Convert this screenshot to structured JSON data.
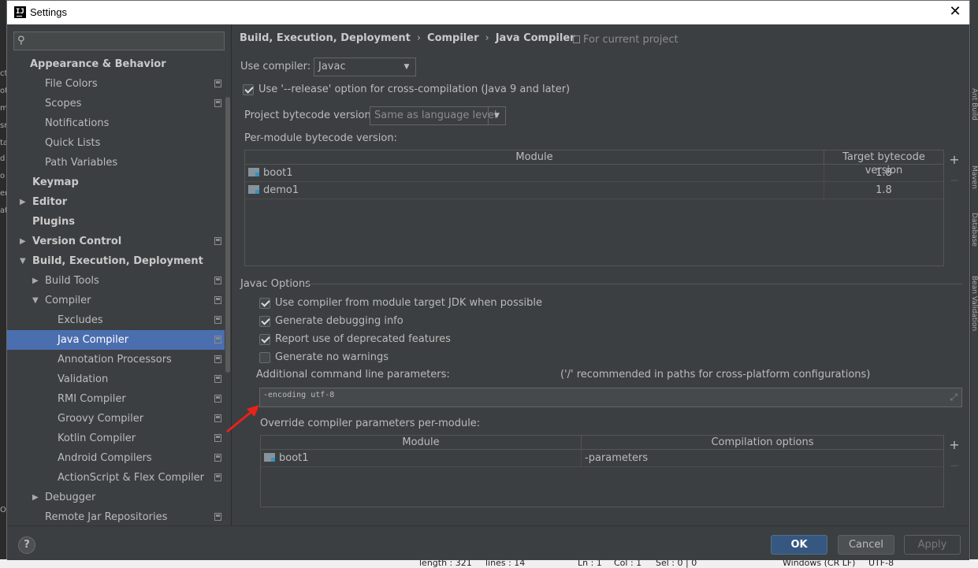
{
  "window": {
    "title": "Settings",
    "close_label": "✕"
  },
  "search": {
    "placeholder": ""
  },
  "tree": [
    {
      "label": "Appearance & Behavior",
      "bold": true,
      "indent": 0,
      "arrow": "",
      "proj": false
    },
    {
      "label": "File Colors",
      "indent": 1,
      "proj": true
    },
    {
      "label": "Scopes",
      "indent": 1,
      "proj": true
    },
    {
      "label": "Notifications",
      "indent": 1,
      "proj": false
    },
    {
      "label": "Quick Lists",
      "indent": 1,
      "proj": false
    },
    {
      "label": "Path Variables",
      "indent": 1,
      "proj": false
    },
    {
      "label": "Keymap",
      "bold": true,
      "indent": 0,
      "proj": false
    },
    {
      "label": "Editor",
      "bold": true,
      "indent": 0,
      "arrow": "▶",
      "proj": false
    },
    {
      "label": "Plugins",
      "bold": true,
      "indent": 0,
      "proj": false
    },
    {
      "label": "Version Control",
      "bold": true,
      "indent": 0,
      "arrow": "▶",
      "proj": true
    },
    {
      "label": "Build, Execution, Deployment",
      "bold": true,
      "indent": 0,
      "arrow": "▼",
      "proj": false
    },
    {
      "label": "Build Tools",
      "indent": 1,
      "arrow": "▶",
      "proj": true
    },
    {
      "label": "Compiler",
      "indent": 1,
      "arrow": "▼",
      "proj": true
    },
    {
      "label": "Excludes",
      "indent": 2,
      "proj": true
    },
    {
      "label": "Java Compiler",
      "indent": 2,
      "proj": true,
      "selected": true
    },
    {
      "label": "Annotation Processors",
      "indent": 2,
      "proj": true
    },
    {
      "label": "Validation",
      "indent": 2,
      "proj": true
    },
    {
      "label": "RMI Compiler",
      "indent": 2,
      "proj": true
    },
    {
      "label": "Groovy Compiler",
      "indent": 2,
      "proj": true
    },
    {
      "label": "Kotlin Compiler",
      "indent": 2,
      "proj": true
    },
    {
      "label": "Android Compilers",
      "indent": 2,
      "proj": true
    },
    {
      "label": "ActionScript & Flex Compiler",
      "indent": 2,
      "proj": true
    },
    {
      "label": "Debugger",
      "indent": 1,
      "arrow": "▶",
      "proj": false
    },
    {
      "label": "Remote Jar Repositories",
      "indent": 1,
      "proj": true
    }
  ],
  "breadcrumb": [
    "Build, Execution, Deployment",
    "Compiler",
    "Java Compiler"
  ],
  "for_current_project": "For current project",
  "use_compiler": {
    "label": "Use compiler:",
    "value": "Javac"
  },
  "release_option": {
    "label": "Use '--release' option for cross-compilation (Java 9 and later)",
    "checked": true
  },
  "project_bytecode": {
    "label": "Project bytecode version:",
    "value": "Same as language level"
  },
  "per_module": {
    "label": "Per-module bytecode version:",
    "columns": [
      "Module",
      "Target bytecode version"
    ],
    "rows": [
      {
        "module": "boot1",
        "version": "1.8"
      },
      {
        "module": "demo1",
        "version": "1.8"
      }
    ]
  },
  "javac_options": {
    "title": "Javac Options",
    "checkboxes": [
      {
        "label": "Use compiler from module target JDK when possible",
        "checked": true
      },
      {
        "label": "Generate debugging info",
        "checked": true
      },
      {
        "label": "Report use of deprecated features",
        "checked": true
      },
      {
        "label": "Generate no warnings",
        "checked": false
      }
    ],
    "additional_label": "Additional command line parameters:",
    "additional_hint": "('/' recommended in paths for cross-platform configurations)",
    "additional_value": "-encoding utf-8"
  },
  "override": {
    "label": "Override compiler parameters per-module:",
    "columns": [
      "Module",
      "Compilation options"
    ],
    "rows": [
      {
        "module": "boot1",
        "options": "-parameters"
      }
    ]
  },
  "table_buttons": {
    "add": "+",
    "remove": "—"
  },
  "footer": {
    "help": "?",
    "ok": "OK",
    "cancel": "Cancel",
    "apply": "Apply"
  },
  "background": {
    "status": [
      "length : 321",
      "lines : 14",
      "Ln : 1",
      "Col : 1",
      "Sel : 0 | 0",
      "Windows (CR LF)",
      "UTF-8"
    ],
    "right_tabs": [
      "Ant Build",
      "Maven",
      "Database",
      "Bean Validation"
    ],
    "left_fragments": [
      "ct",
      "ot",
      "m",
      "sr",
      "ta",
      "d",
      "o",
      "er",
      "at",
      "OC"
    ]
  }
}
